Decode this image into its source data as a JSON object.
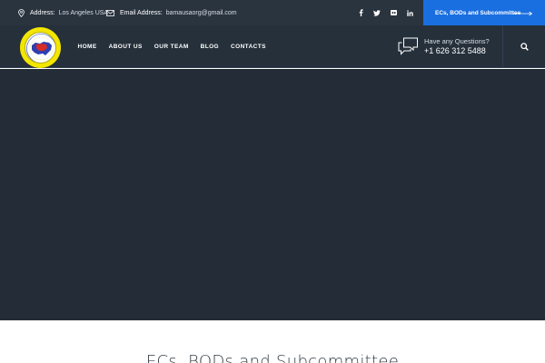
{
  "topbar": {
    "address_label": "Address:",
    "address_value": "Los Angeles USA",
    "email_label": "Email Address:",
    "email_value": "bamausaorg@gmail.com",
    "social_icons": [
      "facebook-icon",
      "twitter-icon",
      "flickr-icon",
      "linkedin-icon"
    ],
    "cta_label": "ECs, BODs and Subcommittee"
  },
  "nav": {
    "items": [
      "HOME",
      "ABOUT US",
      "OUR TEAM",
      "BLOG",
      "CONTACTS"
    ]
  },
  "questions": {
    "label": "Have any Questions?",
    "phone": "+1 626 312 5488"
  },
  "page": {
    "heading": "ECs, BODs and Subcommittee"
  },
  "colors": {
    "topbar_bg": "#2a343f",
    "navbar_bg": "#25303b",
    "hero_bg": "#242d37",
    "accent": "#1a6fe0",
    "logo_yellow": "#f3e600"
  }
}
